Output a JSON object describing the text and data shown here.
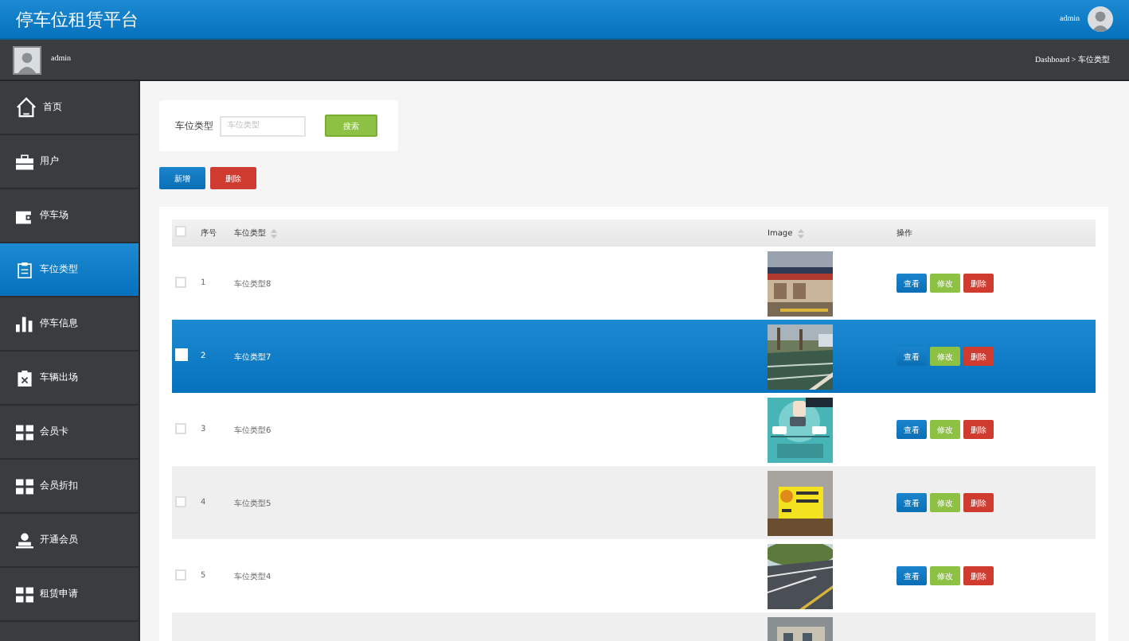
{
  "header": {
    "title": "停车位租赁平台",
    "user": "admin"
  },
  "subbar": {
    "user": "admin",
    "breadcrumb": "Dashboard > 车位类型"
  },
  "sidebar": {
    "items": [
      {
        "label": "首页",
        "kind": "home",
        "selected": false
      },
      {
        "label": "用户",
        "kind": "case",
        "selected": false
      },
      {
        "label": "停车场",
        "kind": "wallet",
        "selected": false
      },
      {
        "label": "车位类型",
        "kind": "clipboard",
        "selected": true
      },
      {
        "label": "停车信息",
        "kind": "bars",
        "selected": false
      },
      {
        "label": "车辆出场",
        "kind": "exit",
        "selected": false
      },
      {
        "label": "会员卡",
        "kind": "grid",
        "selected": false
      },
      {
        "label": "会员折扣",
        "kind": "grid",
        "selected": false
      },
      {
        "label": "开通会员",
        "kind": "user",
        "selected": false
      },
      {
        "label": "租赁申请",
        "kind": "grid",
        "selected": false
      }
    ]
  },
  "search": {
    "label": "车位类型",
    "placeholder": "车位类型",
    "button": "搜索"
  },
  "actions": [
    "新增",
    "删除"
  ],
  "table": {
    "select_all": {
      "checked": false
    },
    "columns": [
      "序号",
      "车位类型",
      "Image",
      "操作"
    ],
    "rows": [
      {
        "index": "1",
        "name": "车位类型8",
        "selected": false,
        "buttons": [
          "查看",
          "修改",
          "删除"
        ]
      },
      {
        "index": "2",
        "name": "车位类型7",
        "selected": true,
        "buttons": [
          "查看",
          "修改",
          "删除"
        ]
      },
      {
        "index": "3",
        "name": "车位类型6",
        "selected": false,
        "buttons": [
          "查看",
          "修改",
          "删除"
        ]
      },
      {
        "index": "4",
        "name": "车位类型5",
        "selected": false,
        "buttons": [
          "查看",
          "修改",
          "删除"
        ]
      },
      {
        "index": "5",
        "name": "车位类型4",
        "selected": false,
        "buttons": [
          "查看",
          "修改",
          "删除"
        ]
      }
    ],
    "partial_row": {
      "kind": "picture"
    }
  }
}
